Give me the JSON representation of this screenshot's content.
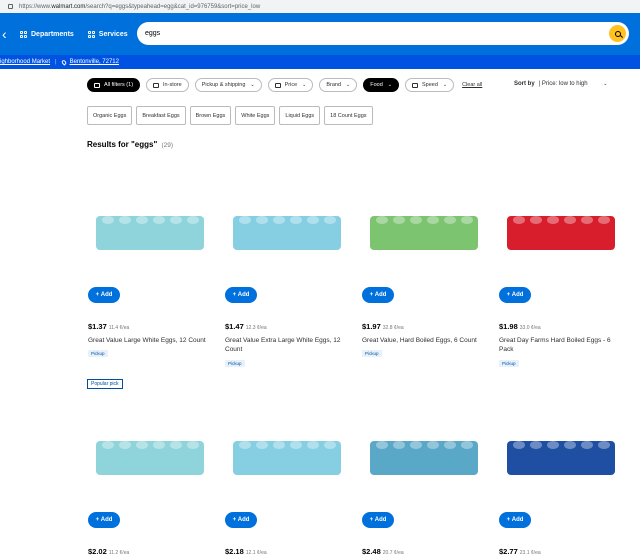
{
  "browser": {
    "url_prefix": "https://www.",
    "url_domain": "walmart.com",
    "url_rest": "/search?q=eggs&typeahead=egg&cat_id=976759&sort=price_low"
  },
  "header": {
    "departments": "Departments",
    "services": "Services",
    "search_value": "eggs",
    "back_icon": "chevron-left-icon"
  },
  "subheader": {
    "store": "ighborhood Market",
    "location": "Bentonville, 72712"
  },
  "filters": [
    {
      "label": "All filters (1)",
      "dark": true,
      "icon": "sliders-icon"
    },
    {
      "label": "In-store",
      "icon": "store-icon"
    },
    {
      "label": "Pickup & shipping",
      "chevron": true
    },
    {
      "label": "Price",
      "chevron": true,
      "icon": "price-icon"
    },
    {
      "label": "Brand",
      "chevron": true
    },
    {
      "label": "Food",
      "dark": true,
      "chevron": true
    },
    {
      "label": "Speed",
      "chevron": true,
      "icon": "speed-icon"
    }
  ],
  "clear_all": "Clear all",
  "sort": {
    "label": "Sort by",
    "value": "Price: low to high"
  },
  "chips": [
    "Organic Eggs",
    "Breakfast Eggs",
    "Brown Eggs",
    "White Eggs",
    "Liquid Eggs",
    "18 Count Eggs"
  ],
  "results": {
    "title": "Results for \"eggs\"",
    "count": "(29)"
  },
  "add_label": "Add",
  "popular_pick": "Popular pick",
  "products": [
    {
      "price": "$1.37",
      "unit": "11.4 ¢/ea",
      "name": "Great Value Large White Eggs, 12 Count",
      "badge": "Pickup",
      "carton_color": "#8fd4da"
    },
    {
      "price": "$1.47",
      "unit": "12.3 ¢/ea",
      "name": "Great Value Extra Large White Eggs, 12 Count",
      "badge": "Pickup",
      "carton_color": "#86cfe3"
    },
    {
      "price": "$1.97",
      "unit": "32.8 ¢/ea",
      "name": "Great Value, Hard Boiled Eggs, 6 Count",
      "badge": "Pickup",
      "carton_color": "#7cc470"
    },
    {
      "price": "$1.98",
      "unit": "33.0 ¢/ea",
      "name": "Great Day Farms Hard Boiled Eggs - 6 Pack",
      "badge": "Pickup",
      "carton_color": "#d81e2c"
    },
    {
      "price": "$2.02",
      "unit": "11.2 ¢/ea",
      "name": "",
      "badge": "",
      "carton_color": "#8fd4da"
    },
    {
      "price": "$2.18",
      "unit": "12.1 ¢/ea",
      "name": "",
      "badge": "",
      "carton_color": "#86cfe3"
    },
    {
      "price": "$2.48",
      "unit": "20.7 ¢/ea",
      "name": "",
      "badge": "",
      "carton_color": "#5aa8c8"
    },
    {
      "price": "$2.77",
      "unit": "23.1 ¢/ea",
      "name": "",
      "badge": "",
      "carton_color": "#1f4fa3"
    }
  ]
}
